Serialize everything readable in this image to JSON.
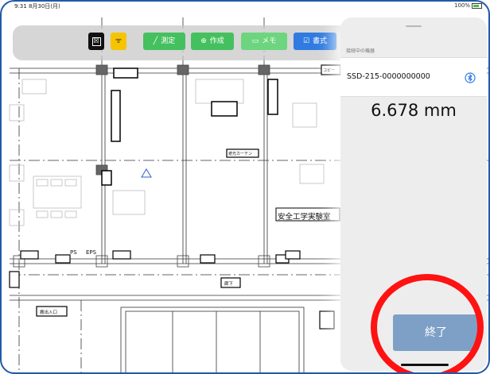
{
  "status": {
    "time": "9:31 8月30日(月)",
    "battery": "100%"
  },
  "toolbar": {
    "close_icon": "☒",
    "wifi_icon": "ᯤ",
    "measure_label": "測定",
    "measure_icon": "╱",
    "create_label": "作成",
    "create_icon": "⊕",
    "memo_label": "メモ",
    "memo_icon": "▭",
    "format_label": "書式",
    "format_icon": "☑"
  },
  "floorplan": {
    "room_label": "安全工学実験室",
    "copy_label": "コピー",
    "corridor_label": "廊下",
    "entrance_label": "搬出入口",
    "curtain_label": "遮光カーテン",
    "ps_label": "PS",
    "eps_label": "EPS"
  },
  "panel": {
    "connected_label": "接続中の機器",
    "device_name": "SSD-215-0000000000",
    "measurement": "6.678 mm",
    "end_label": "終了"
  },
  "colors": {
    "accent": "#2f7be0",
    "green": "#45c05f",
    "yellow": "#f6c400",
    "end_button": "#7ea0c7",
    "highlight": "#ff1212",
    "frame": "#1f5aa8"
  }
}
